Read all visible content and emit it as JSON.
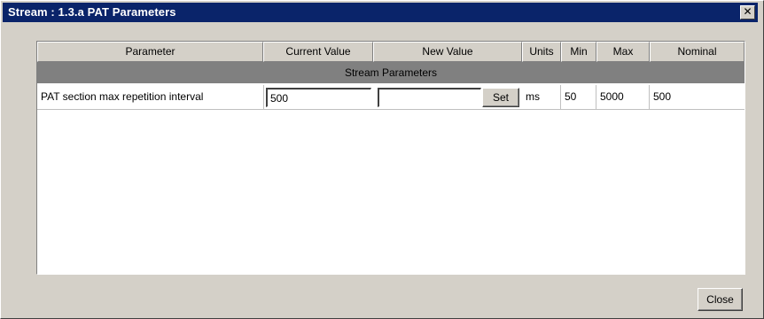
{
  "window": {
    "title": "Stream : 1.3.a PAT Parameters",
    "close_glyph": "✕"
  },
  "table": {
    "columns": [
      "Parameter",
      "Current Value",
      "New Value",
      "Units",
      "Min",
      "Max",
      "Nominal"
    ],
    "group_label": "Stream Parameters",
    "rows": [
      {
        "parameter": "PAT section max repetition interval",
        "current_value": "500",
        "new_value": "",
        "set_label": "Set",
        "units": "ms",
        "min": "50",
        "max": "5000",
        "nominal": "500"
      }
    ]
  },
  "footer": {
    "close_label": "Close"
  }
}
